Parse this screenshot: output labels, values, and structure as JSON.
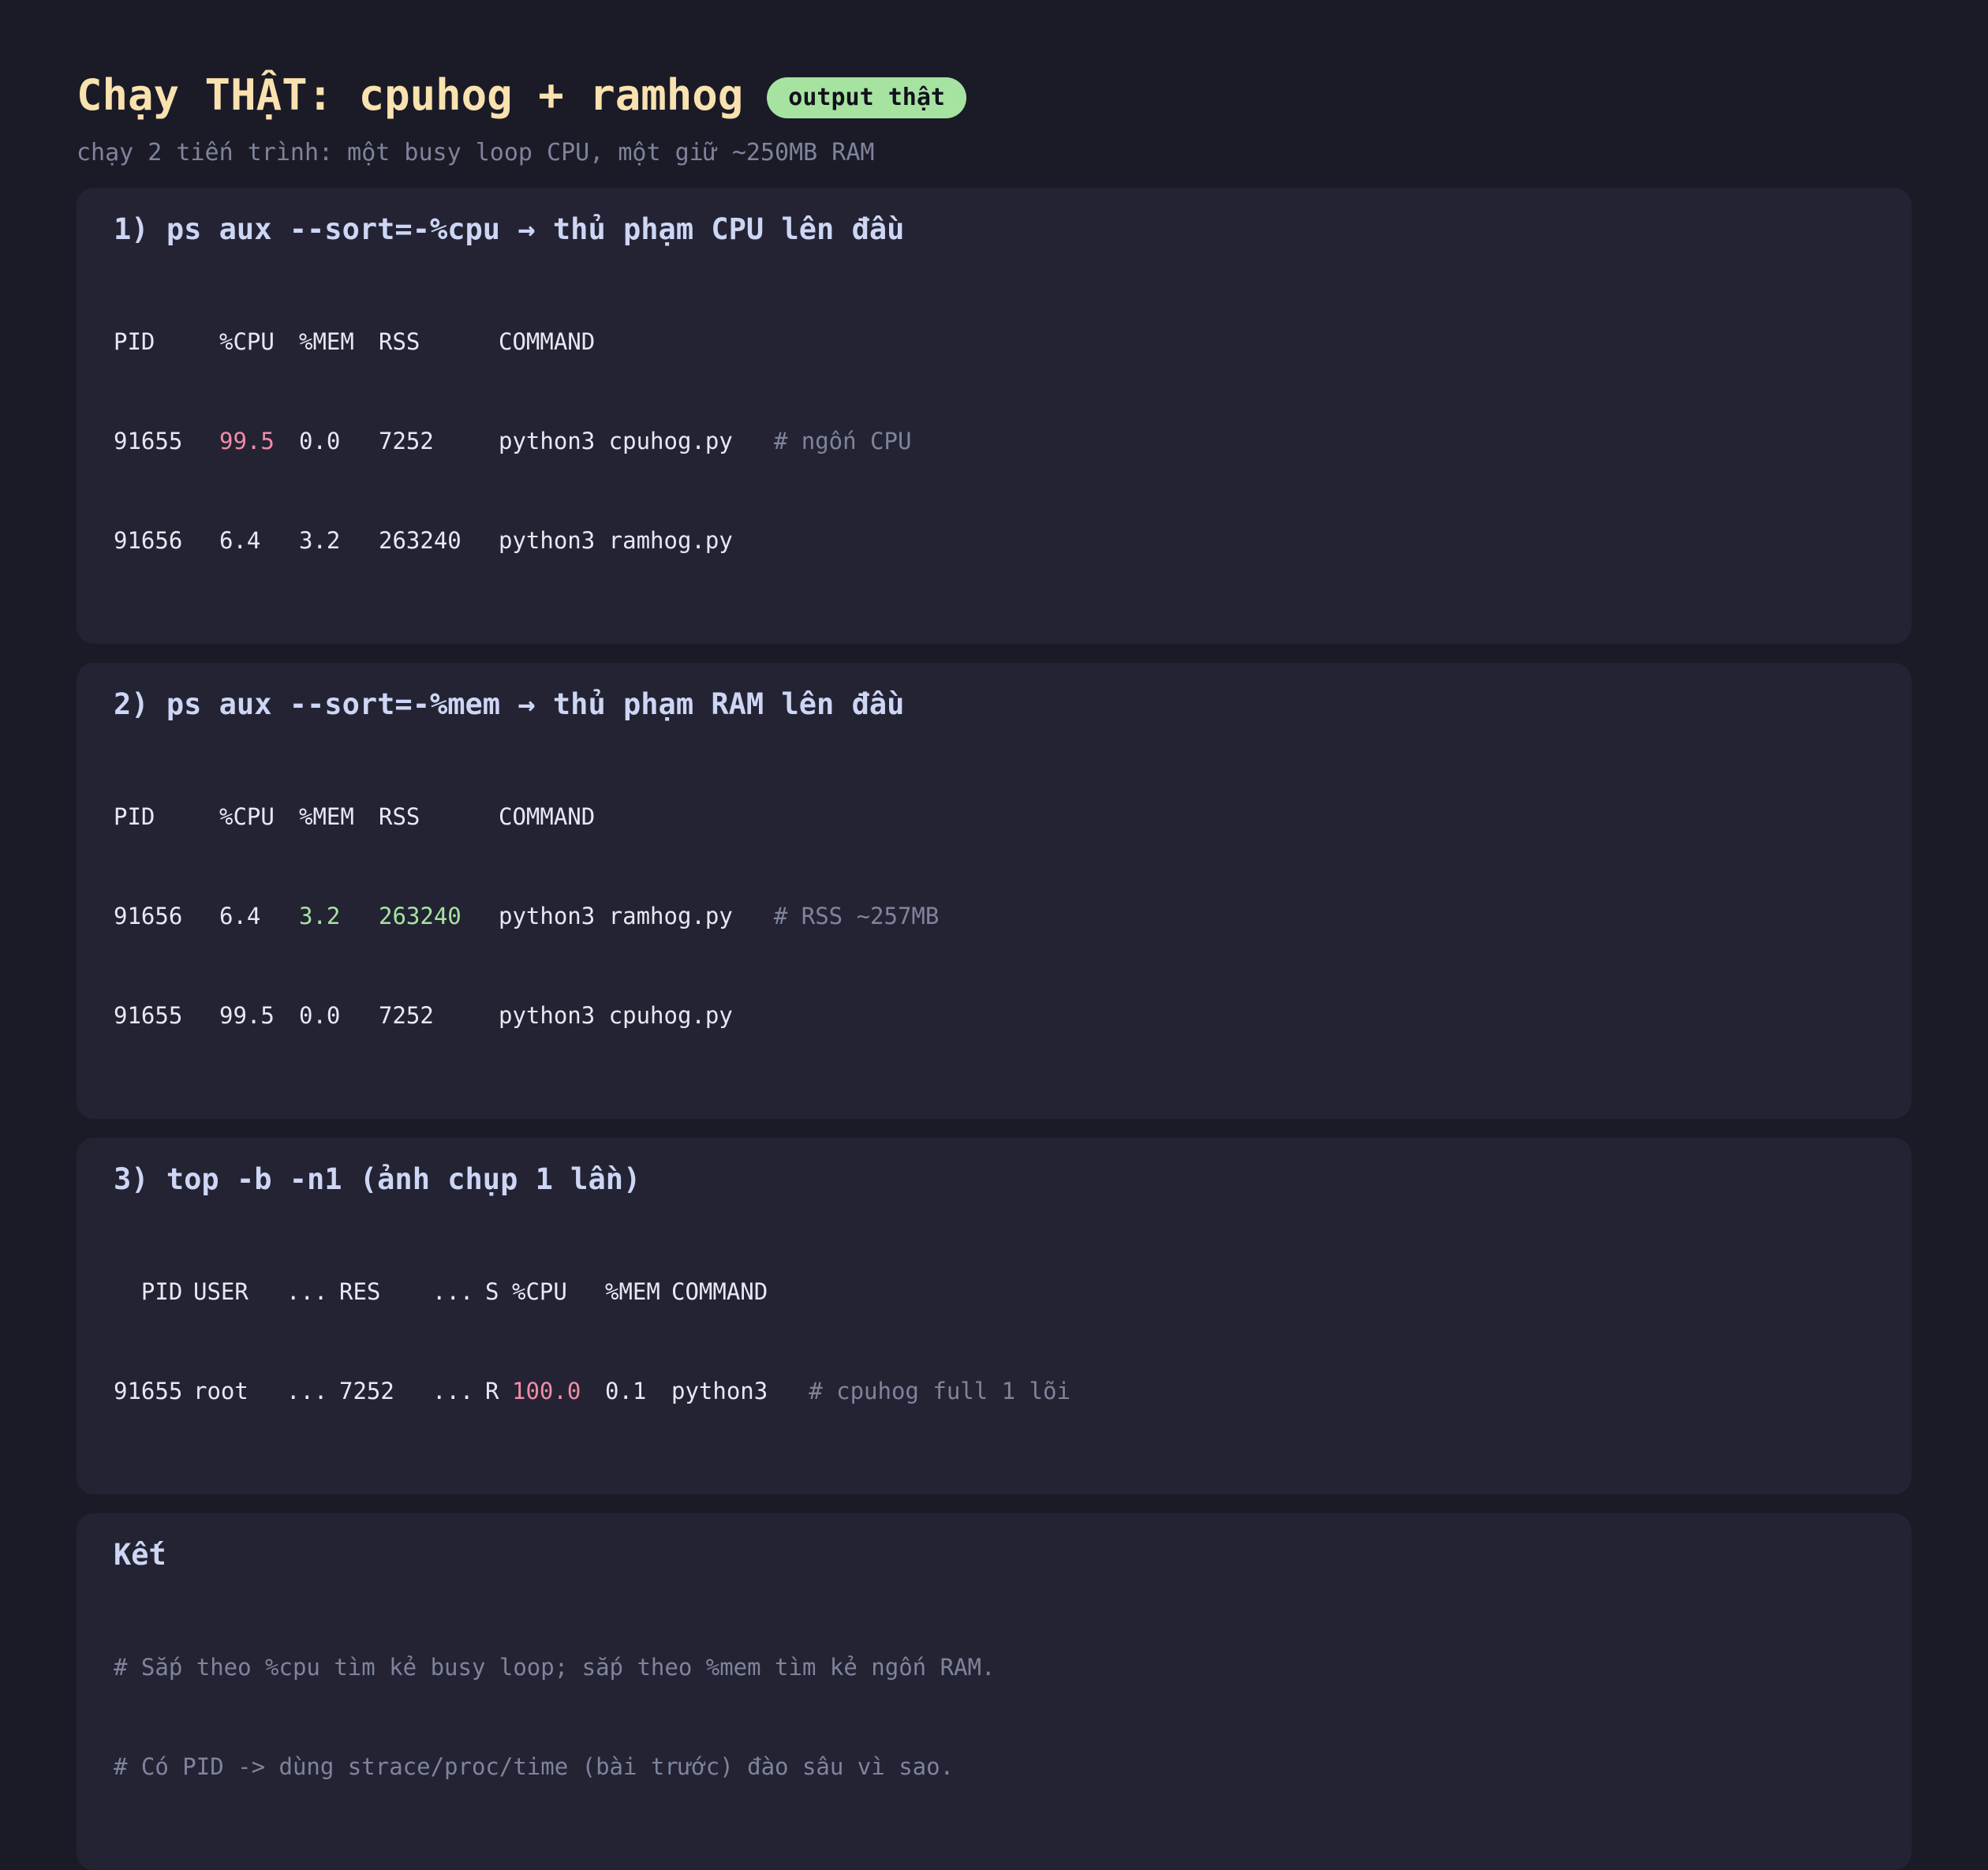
{
  "header": {
    "title": "Chạy THẬT: cpuhog + ramhog",
    "badge": "output thật",
    "subtitle": "chạy 2 tiến trình: một busy loop CPU, một giữ ~250MB RAM"
  },
  "sections": [
    {
      "title": "1) ps aux --sort=-%cpu → thủ phạm CPU lên đầu",
      "columns": [
        "PID",
        "%CPU",
        "%MEM",
        "RSS",
        "COMMAND"
      ],
      "rows": [
        {
          "pid": "91655",
          "cpu": "99.5",
          "mem": "0.0",
          "rss": "7252",
          "command": "python3 cpuhog.py",
          "comment": "# ngốn CPU"
        },
        {
          "pid": "91656",
          "cpu": "6.4",
          "mem": "3.2",
          "rss": "263240",
          "command": "python3 ramhog.py",
          "comment": ""
        }
      ]
    },
    {
      "title": "2) ps aux --sort=-%mem → thủ phạm RAM lên đầu",
      "columns": [
        "PID",
        "%CPU",
        "%MEM",
        "RSS",
        "COMMAND"
      ],
      "rows": [
        {
          "pid": "91656",
          "cpu": "6.4",
          "mem": "3.2",
          "rss": "263240",
          "command": "python3 ramhog.py",
          "comment": "# RSS ~257MB"
        },
        {
          "pid": "91655",
          "cpu": "99.5",
          "mem": "0.0",
          "rss": "7252",
          "command": "python3 cpuhog.py",
          "comment": ""
        }
      ]
    },
    {
      "title": "3) top -b -n1 (ảnh chụp 1 lần)",
      "columns": [
        "  PID",
        "USER",
        "...",
        "RES",
        "...",
        "S",
        "%CPU",
        "%MEM",
        "COMMAND"
      ],
      "rows": [
        {
          "pid": "91655",
          "user": "root",
          "dots1": "...",
          "res": "7252",
          "dots2": "...",
          "s": "R",
          "cpu": "100.0",
          "mem": "0.1",
          "command": "python3",
          "comment": "# cpuhog full 1 lõi"
        }
      ]
    }
  ],
  "summary": {
    "title": "Kết",
    "lines": [
      "# Sắp theo %cpu tìm kẻ busy loop; sắp theo %mem tìm kẻ ngốn RAM.",
      "# Có PID -> dùng strace/proc/time (bài trước) đào sâu vì sao."
    ]
  },
  "colors": {
    "background": "#1b1b27",
    "card": "#232333",
    "title": "#f9e2af",
    "badge": "#a6e3a1",
    "highlight_cpu": "#f38ba8",
    "highlight_mem": "#a6e3a1",
    "comment": "#7f849c"
  }
}
